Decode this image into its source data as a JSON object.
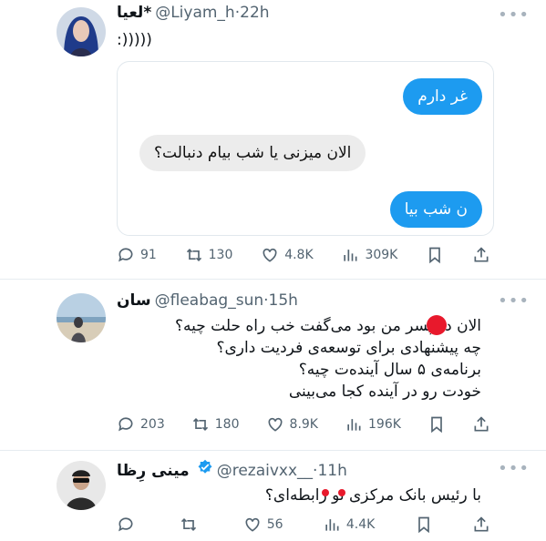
{
  "tweets": [
    {
      "name": "لعیا*",
      "handle": "@Liyam_h",
      "dot": "·",
      "time": "22h",
      "text": ":)))))",
      "bubbles": [
        "غر دارم",
        "الان میزنی یا شب بیام دنبالت؟",
        "ن شب بیا"
      ],
      "replies": "91",
      "retweets": "130",
      "likes": "4.8K",
      "views": "309K"
    },
    {
      "name": "سان",
      "handle": "@fleabag_sun",
      "dot": "·",
      "time": "15h",
      "lines": [
        "الان دو   پسر من بود می‌گفت خب راه حلت چیه؟",
        "چه پیشنهادی برای توسعه‌ی فردیت داری؟",
        "برنامه‌ی ۵ سال آینده‌ت چیه؟",
        "خودت رو در آینده کجا می‌بینی"
      ],
      "replies": "203",
      "retweets": "180",
      "likes": "8.9K",
      "views": "196K"
    },
    {
      "name": "مینی رِظا",
      "handle": "@rezaivxx__",
      "dot": "·",
      "time": "11h",
      "text": "با رئیس بانک مرکزی تو رابطه‌ای؟",
      "replies": "",
      "retweets": "",
      "likes": "56",
      "views": "4.4K"
    }
  ],
  "icons": {
    "reply": "reply-icon",
    "retweet": "retweet-icon",
    "like": "heart-icon",
    "views": "views-icon",
    "bookmark": "bookmark-icon",
    "share": "share-icon",
    "more": "more-icon",
    "verified": "verified-badge-icon"
  },
  "colors": {
    "accent": "#1d9bf0",
    "muted": "#536471",
    "redact": "#e8192c"
  }
}
